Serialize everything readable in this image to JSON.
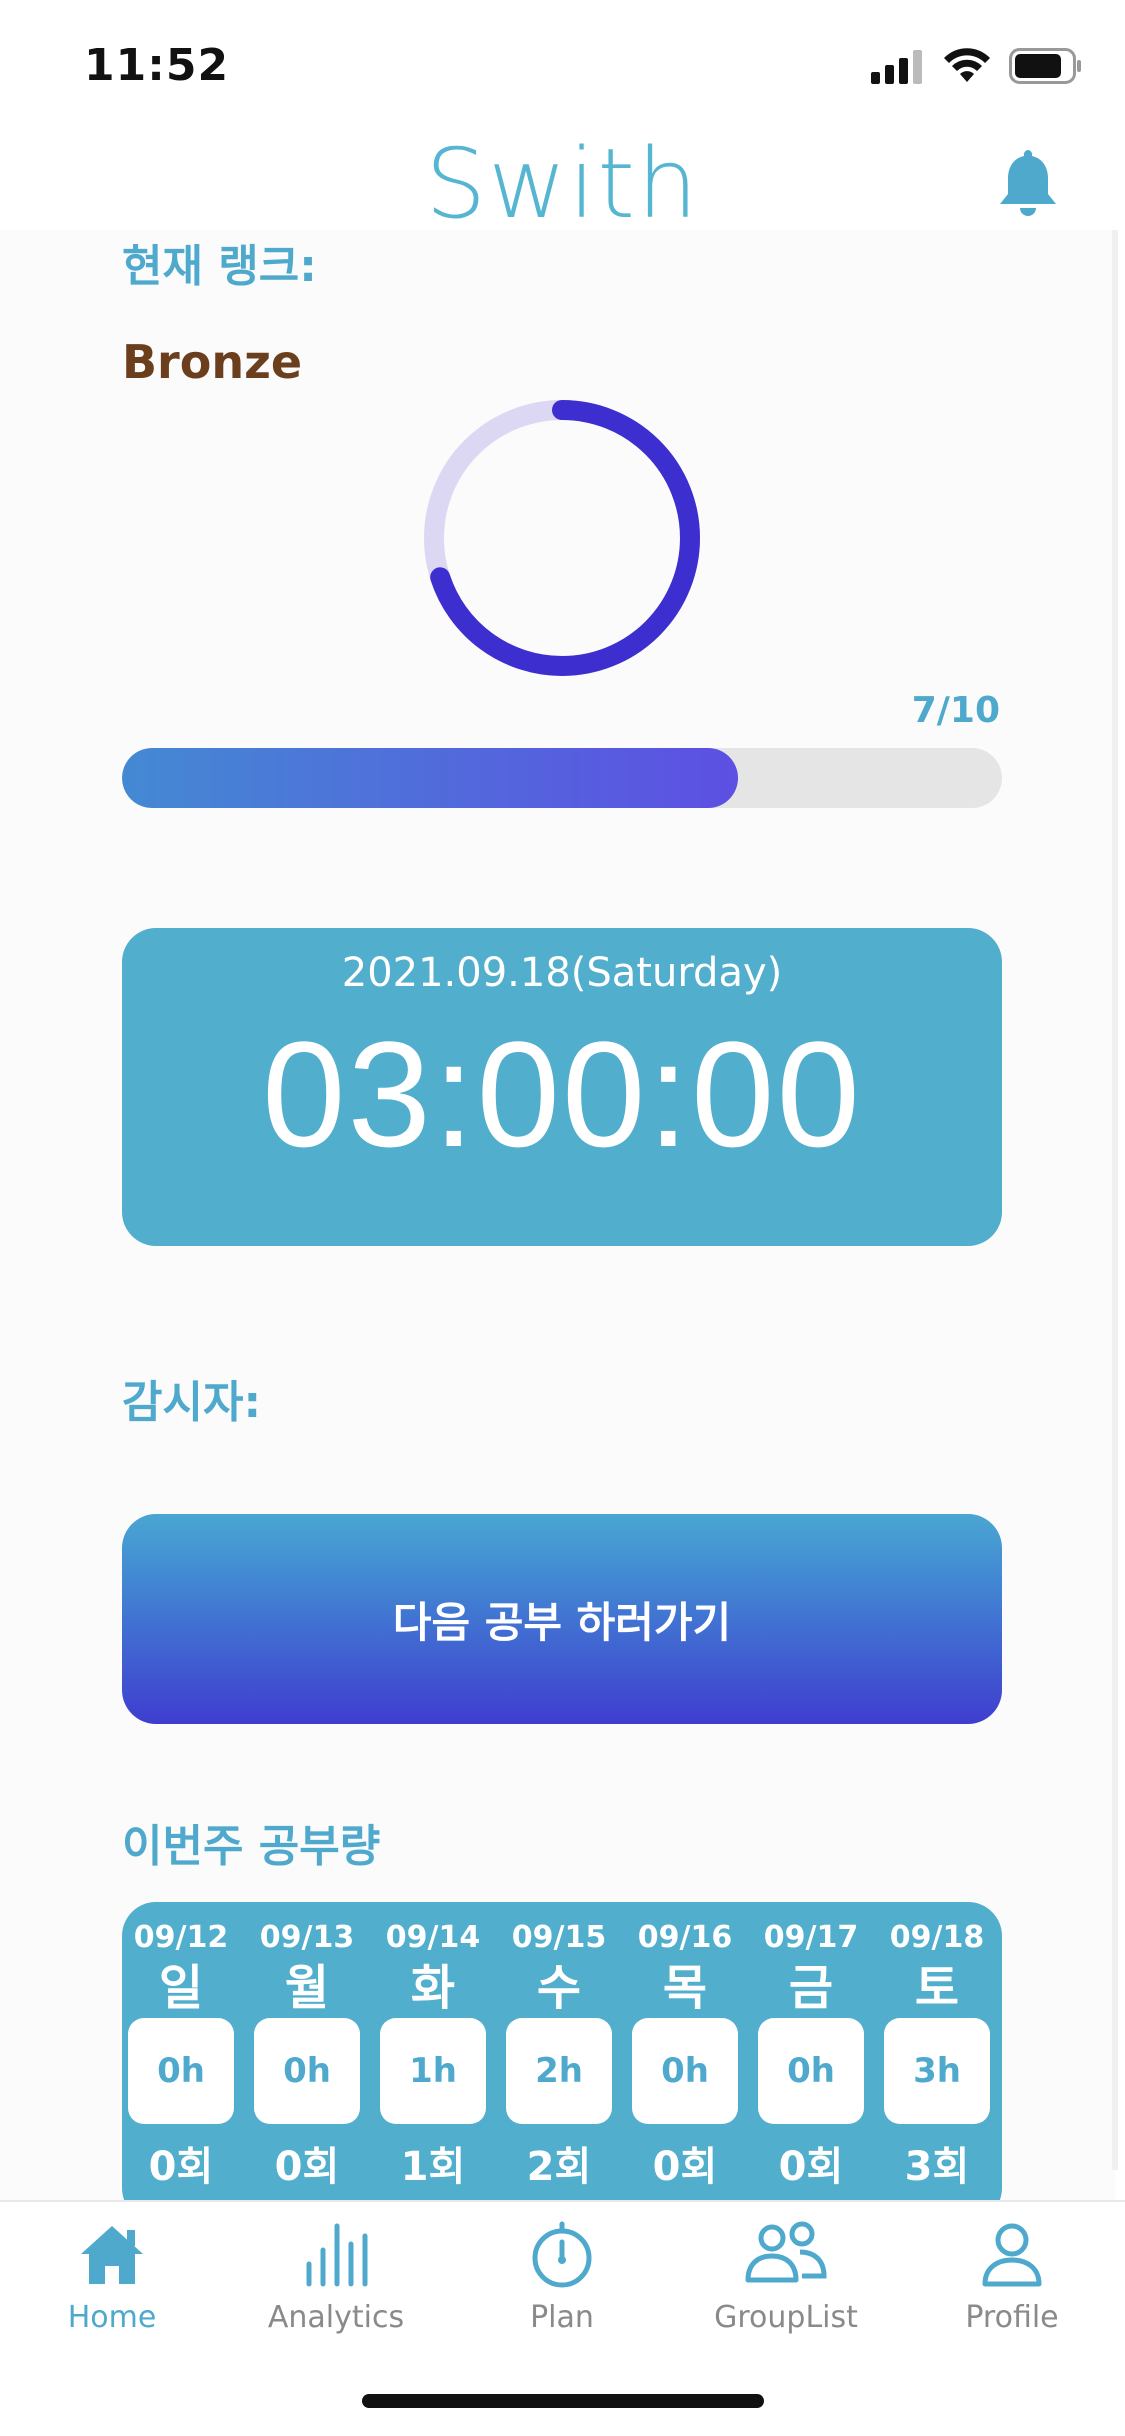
{
  "status_bar": {
    "time": "11:52"
  },
  "header": {
    "title": "Swith"
  },
  "rank": {
    "label": "현재 랭크:",
    "name": "Bronze",
    "progress_text": "7/10",
    "progress": 0.7
  },
  "timer": {
    "date": "2021.09.18(Saturday)",
    "clock": "03:00:00"
  },
  "monitor": {
    "label": "감시자:"
  },
  "study_button": {
    "label": "다음 공부 하러가기"
  },
  "weekly": {
    "label": "이번주 공부량",
    "days": [
      {
        "date": "09/12",
        "day": "일",
        "hours": "0h",
        "count": "0회"
      },
      {
        "date": "09/13",
        "day": "월",
        "hours": "0h",
        "count": "0회"
      },
      {
        "date": "09/14",
        "day": "화",
        "hours": "1h",
        "count": "1회"
      },
      {
        "date": "09/15",
        "day": "수",
        "hours": "2h",
        "count": "2회"
      },
      {
        "date": "09/16",
        "day": "목",
        "hours": "0h",
        "count": "0회"
      },
      {
        "date": "09/17",
        "day": "금",
        "hours": "0h",
        "count": "0회"
      },
      {
        "date": "09/18",
        "day": "토",
        "hours": "3h",
        "count": "3회"
      }
    ]
  },
  "tabs": [
    {
      "label": "Home",
      "icon": "home-icon",
      "active": true
    },
    {
      "label": "Analytics",
      "icon": "analytics-icon",
      "active": false
    },
    {
      "label": "Plan",
      "icon": "stopwatch-icon",
      "active": false
    },
    {
      "label": "GroupList",
      "icon": "group-icon",
      "active": false
    },
    {
      "label": "Profile",
      "icon": "profile-icon",
      "active": false
    }
  ],
  "colors": {
    "accent": "#4ea9cc",
    "card": "#51aecd",
    "ring": "#3d2fcf",
    "ring_track": "#dcd8f3",
    "rank_bronze": "#6b3f1d"
  }
}
